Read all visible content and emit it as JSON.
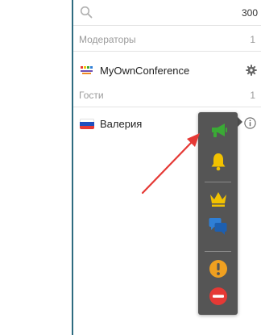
{
  "search": {
    "icon": "search-icon",
    "placeholder": "",
    "value": "",
    "count": "300"
  },
  "sections": {
    "moderators": {
      "label": "Модераторы",
      "count": "1"
    },
    "guests": {
      "label": "Гости",
      "count": "1"
    }
  },
  "moderator_user": {
    "name": "MyOwnConference",
    "logo_icon": "myownconference-logo-icon",
    "action_icon": "gear-icon"
  },
  "guest_user": {
    "name": "Валерия",
    "flag_icon": "russia-flag-icon",
    "action_icon": "info-icon"
  },
  "action_menu": {
    "items": [
      {
        "name": "megaphone-icon",
        "color": "#3aaa35"
      },
      {
        "name": "bell-icon",
        "color": "#f2c200"
      },
      {
        "name": "crown-icon",
        "color": "#f2c200"
      },
      {
        "name": "chat-bubbles-icon",
        "color": "#2f7fd6"
      },
      {
        "name": "warning-icon",
        "color": "#f0a020"
      },
      {
        "name": "block-icon",
        "color": "#e53935"
      }
    ]
  },
  "colors": {
    "divider": "#2e6b80",
    "menu_background": "#555555",
    "annotation_arrow": "#e53935",
    "muted_text": "#9a9a9a"
  }
}
